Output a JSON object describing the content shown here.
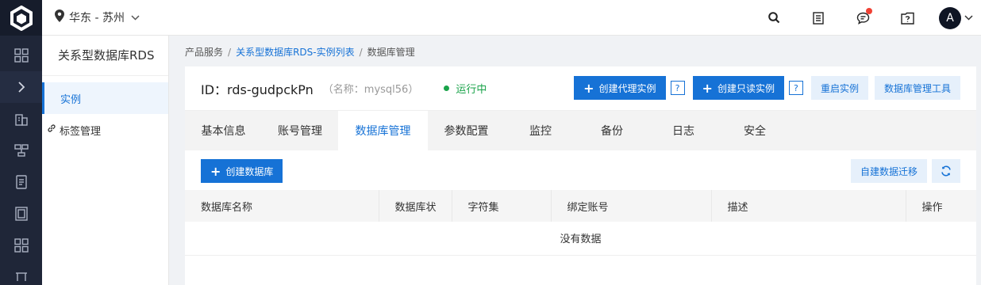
{
  "topbar": {
    "region": "华东 - 苏州",
    "avatar_initial": "A"
  },
  "sidebar": {
    "title": "关系型数据库RDS",
    "items": [
      {
        "label": "实例"
      },
      {
        "label": "标签管理"
      }
    ]
  },
  "breadcrumb": [
    "产品服务",
    "关系型数据库RDS-实例列表",
    "数据库管理"
  ],
  "instance": {
    "id_text": "ID：rds-gudpckPn",
    "name_text": "（名称：mysql56）",
    "status": "运行中",
    "status_color": "#1aa34a"
  },
  "actions": {
    "create_proxy": "创建代理实例",
    "create_readonly": "创建只读实例",
    "help": "?",
    "restart": "重启实例",
    "db_tool": "数据库管理工具"
  },
  "tabs": [
    "基本信息",
    "账号管理",
    "数据库管理",
    "参数配置",
    "监控",
    "备份",
    "日志",
    "安全"
  ],
  "toolbar": {
    "create_db": "创建数据库",
    "migrate": "自建数据迁移"
  },
  "table": {
    "columns": [
      "数据库名称",
      "数据库状",
      "字符集",
      "绑定账号",
      "描述",
      "操作"
    ],
    "empty_text": "没有数据"
  },
  "colors": {
    "accent": "#1672d6",
    "rail": "#1f2638",
    "notification": "#f04134"
  }
}
